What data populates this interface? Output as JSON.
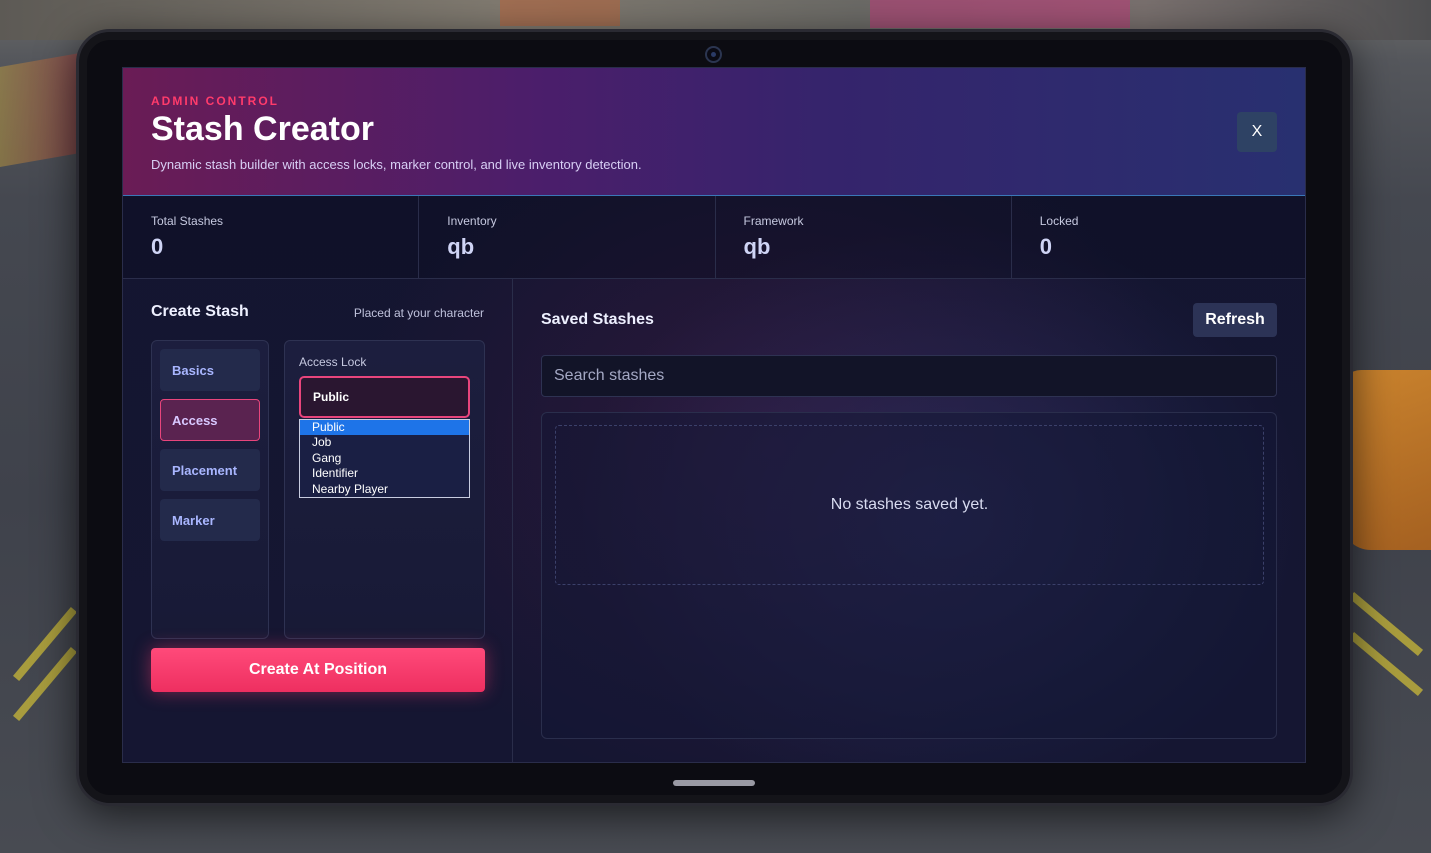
{
  "header": {
    "eyebrow": "ADMIN CONTROL",
    "title": "Stash Creator",
    "subtitle": "Dynamic stash builder with access locks, marker control, and live inventory detection.",
    "close_label": "X"
  },
  "stats": [
    {
      "label": "Total Stashes",
      "value": "0"
    },
    {
      "label": "Inventory",
      "value": "qb"
    },
    {
      "label": "Framework",
      "value": "qb"
    },
    {
      "label": "Locked",
      "value": "0"
    }
  ],
  "create": {
    "title": "Create Stash",
    "hint": "Placed at your character",
    "nav": [
      {
        "label": "Basics",
        "active": false
      },
      {
        "label": "Access",
        "active": true
      },
      {
        "label": "Placement",
        "active": false
      },
      {
        "label": "Marker",
        "active": false
      }
    ],
    "access_lock": {
      "label": "Access Lock",
      "selected": "Public",
      "options": [
        "Public",
        "Job",
        "Gang",
        "Identifier",
        "Nearby Player"
      ]
    },
    "submit_label": "Create At Position"
  },
  "saved": {
    "title": "Saved Stashes",
    "refresh_label": "Refresh",
    "search_placeholder": "Search stashes",
    "search_value": "",
    "empty_text": "No stashes saved yet."
  },
  "colors": {
    "accent": "#ff3b6b",
    "active_nav": "#5a2350",
    "select_highlight": "#1e74e8"
  }
}
